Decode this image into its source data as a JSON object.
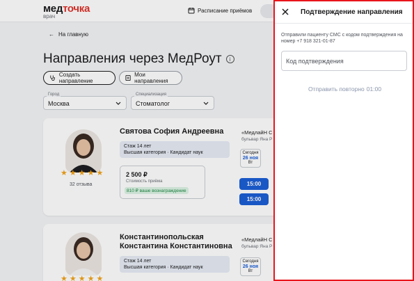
{
  "header": {
    "logo_main": "мед",
    "logo_accent": "точка",
    "logo_sub": "врач",
    "schedule_label": "Расписание приёмов"
  },
  "page": {
    "back_label": "На главную",
    "title": "Направления через МедРоут",
    "create_label": "Создать направление",
    "my_label": "Мои направления",
    "city_label": "Город",
    "city_value": "Москва",
    "spec_label": "Специализация",
    "spec_value": "Стоматолог"
  },
  "doctors": [
    {
      "name": "Святова София Андреевна",
      "experience": "Стаж 14 лет",
      "category": "Высшая категория · Кандидат наук",
      "reviews": "32 отзыва",
      "price": "2 500 ₽",
      "price_sub": "Стоимость приёма",
      "reward": "810 ₽ ваше вознаграждение",
      "clinic": "«МедлайН С",
      "clinic_address": "бульвар Яна Р",
      "date_label": "Сегодня",
      "date_day": "26 ноя",
      "date_weekday": "Вт",
      "times": [
        "15:00",
        "15:00"
      ]
    },
    {
      "name_line1": "Константинопольская",
      "name_line2": "Константина Константиновна",
      "experience": "Стаж 14 лет",
      "category": "Высшая категория · Кандидат наук",
      "clinic": "«МедлайН С",
      "clinic_address": "бульвар Яна Р",
      "date_label": "Сегодня",
      "date_day": "26 ноя",
      "date_weekday": "Вт"
    }
  ],
  "drawer": {
    "title": "Подтверждение направления",
    "description": "Отправили пациенту СМС с кодом подтверждения на номер +7 918 321-01-87",
    "code_placeholder": "Код подтверждения",
    "resend_label": "Отправить повторно",
    "resend_timer": "01:00"
  },
  "colors": {
    "accent_blue": "#1c5fd6",
    "brand_red": "#e0332b",
    "highlight_border": "#e8141c",
    "star": "#f2a31a"
  }
}
